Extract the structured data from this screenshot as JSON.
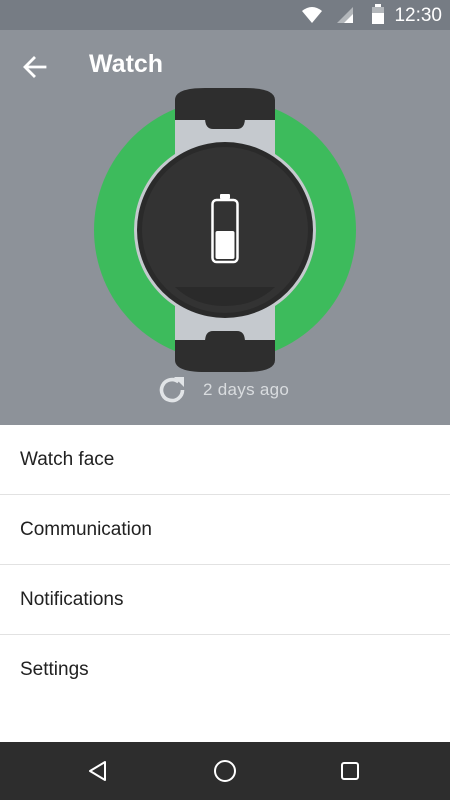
{
  "status_bar": {
    "time": "12:30",
    "icons": [
      "wifi-icon",
      "cell-signal-icon",
      "battery-icon"
    ]
  },
  "header": {
    "title": "Watch",
    "back_icon": "arrow-back-icon"
  },
  "watch": {
    "ring_color": "#3dbb5c",
    "battery_icon": "battery-half-icon",
    "battery_level": 0.5
  },
  "sync": {
    "icon": "refresh-icon",
    "text": "2 days ago"
  },
  "menu": {
    "items": [
      {
        "label": "Watch face"
      },
      {
        "label": "Communication"
      },
      {
        "label": "Notifications"
      },
      {
        "label": "Settings"
      }
    ]
  },
  "nav_bar": {
    "icons": [
      "nav-back-icon",
      "nav-home-icon",
      "nav-recents-icon"
    ]
  },
  "colors": {
    "hero_bg": "#8d9299",
    "status_bar_bg": "#767c84",
    "nav_bar_bg": "#2d2d2d",
    "accent": "#3dbb5c"
  }
}
